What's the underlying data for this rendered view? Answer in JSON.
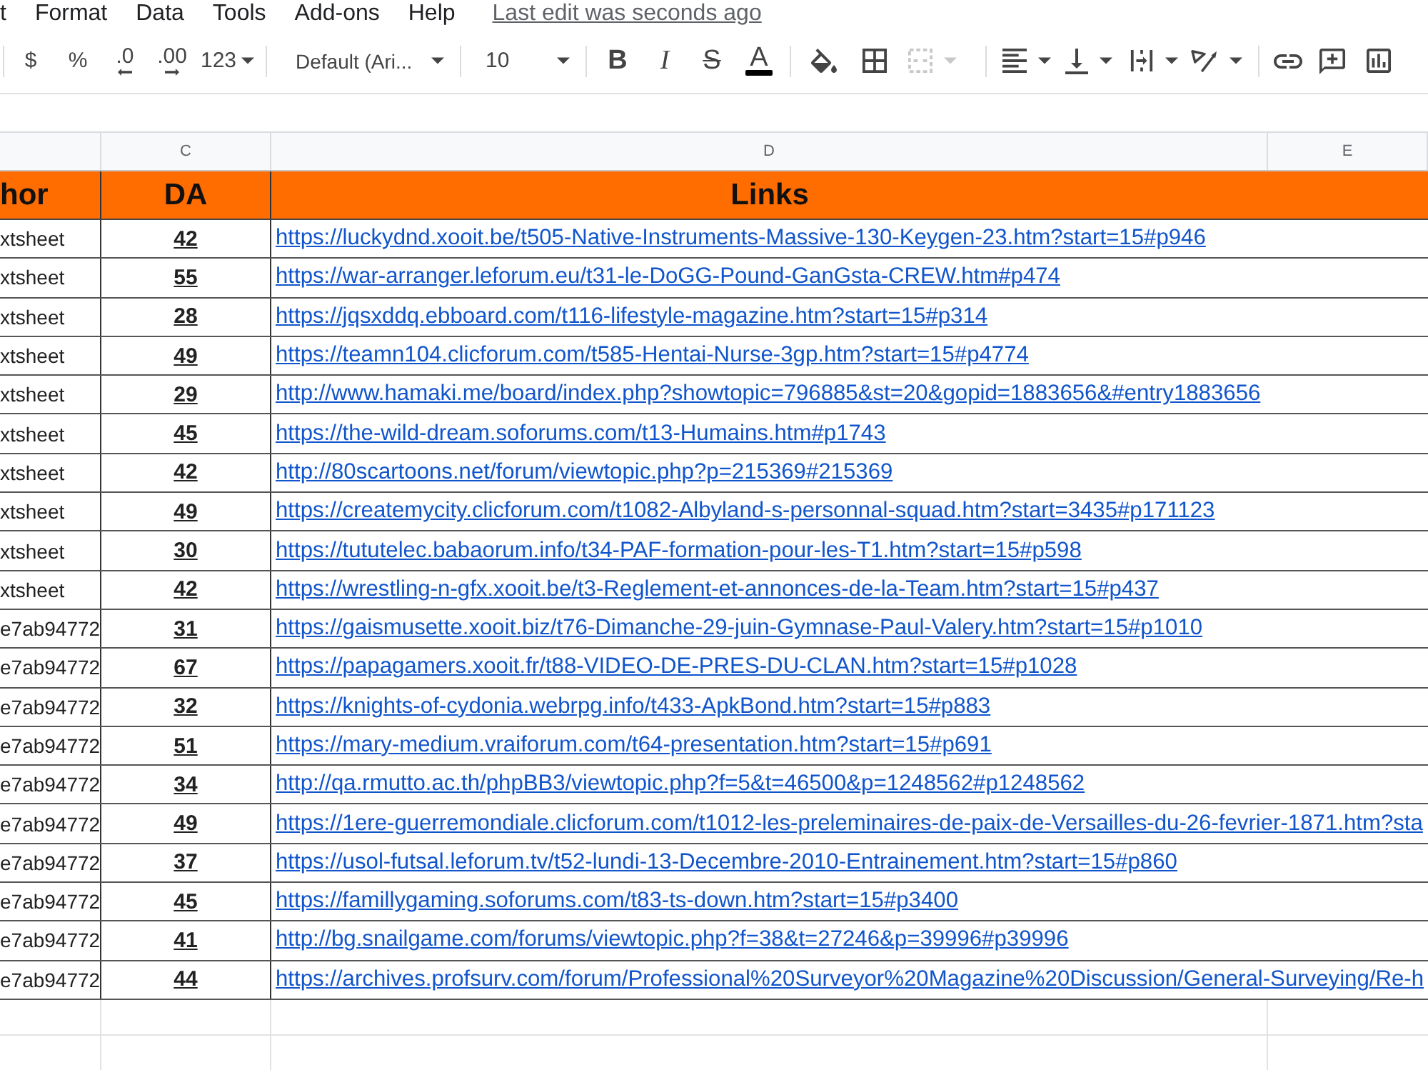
{
  "menu_bar": {
    "items": [
      "t",
      "Format",
      "Data",
      "Tools",
      "Add-ons",
      "Help"
    ],
    "last_edit": "Last edit was seconds ago"
  },
  "toolbar": {
    "groups": [
      [
        {
          "kind": "currency",
          "label": "$",
          "disabled": false
        },
        {
          "kind": "percent",
          "label": "%",
          "disabled": false
        },
        {
          "kind": "decrease_decimals",
          "label": ".0",
          "disabled": false
        },
        {
          "kind": "increase_decimals",
          "label": ".00",
          "disabled": false
        },
        {
          "kind": "more_formats",
          "label": "123",
          "dropdown": true,
          "disabled": false
        }
      ],
      [
        {
          "kind": "font",
          "value": "Default (Ari...",
          "dropdown": true,
          "disabled": false
        }
      ],
      [
        {
          "kind": "font_size",
          "value": "10",
          "dropdown": true,
          "disabled": false
        }
      ],
      [
        {
          "kind": "bold",
          "label": "B",
          "disabled": false
        },
        {
          "kind": "italic",
          "label": "I",
          "disabled": false
        },
        {
          "kind": "strikethrough",
          "label": "S",
          "disabled": false
        },
        {
          "kind": "text_color",
          "label": "A",
          "disabled": false
        }
      ],
      [
        {
          "kind": "fill_color",
          "disabled": false
        },
        {
          "kind": "borders",
          "disabled": false
        },
        {
          "kind": "merge",
          "dropdown": true,
          "disabled": true
        }
      ],
      [
        {
          "kind": "align",
          "dropdown": true,
          "disabled": false
        },
        {
          "kind": "valign",
          "dropdown": true,
          "disabled": false
        },
        {
          "kind": "wrap",
          "dropdown": true,
          "disabled": false
        },
        {
          "kind": "rotate",
          "dropdown": true,
          "disabled": false
        }
      ],
      [
        {
          "kind": "link",
          "disabled": false
        },
        {
          "kind": "comment",
          "disabled": false
        },
        {
          "kind": "chart",
          "disabled": false
        }
      ]
    ]
  },
  "sheet": {
    "column_letters": [
      "C",
      "D",
      "E"
    ],
    "header": [
      "hor",
      "DA",
      "Links"
    ],
    "rows": [
      [
        "xtsheet",
        "42",
        "https://luckydnd.xooit.be/t505-Native-Instruments-Massive-130-Keygen-23.htm?start=15#p946"
      ],
      [
        "xtsheet",
        "55",
        "https://war-arranger.leforum.eu/t31-le-DoGG-Pound-GanGsta-CREW.htm#p474"
      ],
      [
        "xtsheet",
        "28",
        "https://jqsxddq.ebboard.com/t116-lifestyle-magazine.htm?start=15#p314"
      ],
      [
        "xtsheet",
        "49",
        "https://teamn104.clicforum.com/t585-Hentai-Nurse-3gp.htm?start=15#p4774"
      ],
      [
        "xtsheet",
        "29",
        "http://www.hamaki.me/board/index.php?showtopic=796885&st=20&gopid=1883656&#entry1883656"
      ],
      [
        "xtsheet",
        "45",
        "https://the-wild-dream.soforums.com/t13-Humains.htm#p1743"
      ],
      [
        "xtsheet",
        "42",
        "http://80scartoons.net/forum/viewtopic.php?p=215369#215369"
      ],
      [
        "xtsheet",
        "49",
        "https://createmycity.clicforum.com/t1082-Albyland-s-personnal-squad.htm?start=3435#p171123"
      ],
      [
        "xtsheet",
        "30",
        "https://tututelec.babaorum.info/t34-PAF-formation-pour-les-T1.htm?start=15#p598"
      ],
      [
        "xtsheet",
        "42",
        "https://wrestling-n-gfx.xooit.be/t3-Reglement-et-annonces-de-la-Team.htm?start=15#p437"
      ],
      [
        "e7ab94772",
        "31",
        "https://gaismusette.xooit.biz/t76-Dimanche-29-juin-Gymnase-Paul-Valery.htm?start=15#p1010"
      ],
      [
        "e7ab94772",
        "67",
        "https://papagamers.xooit.fr/t88-VIDEO-DE-PRES-DU-CLAN.htm?start=15#p1028"
      ],
      [
        "e7ab94772",
        "32",
        "https://knights-of-cydonia.webrpg.info/t433-ApkBond.htm?start=15#p883"
      ],
      [
        "e7ab94772",
        "51",
        "https://mary-medium.vraiforum.com/t64-presentation.htm?start=15#p691"
      ],
      [
        "e7ab94772",
        "34",
        "http://qa.rmutto.ac.th/phpBB3/viewtopic.php?f=5&t=46500&p=1248562#p1248562"
      ],
      [
        "e7ab94772",
        "49",
        "https://1ere-guerremondiale.clicforum.com/t1012-les-preleminaires-de-paix-de-Versailles-du-26-fevrier-1871.htm?sta"
      ],
      [
        "e7ab94772",
        "37",
        "https://usol-futsal.leforum.tv/t52-lundi-13-Decembre-2010-Entrainement.htm?start=15#p860"
      ],
      [
        "e7ab94772",
        "45",
        "https://famillygaming.soforums.com/t83-ts-down.htm?start=15#p3400"
      ],
      [
        "e7ab94772",
        "41",
        "http://bg.snailgame.com/forums/viewtopic.php?f=38&t=27246&p=39996#p39996"
      ],
      [
        "e7ab94772",
        "44",
        "https://archives.profsurv.com/forum/Professional%20Surveyor%20Magazine%20Discussion/General-Surveying/Re-h"
      ]
    ]
  }
}
